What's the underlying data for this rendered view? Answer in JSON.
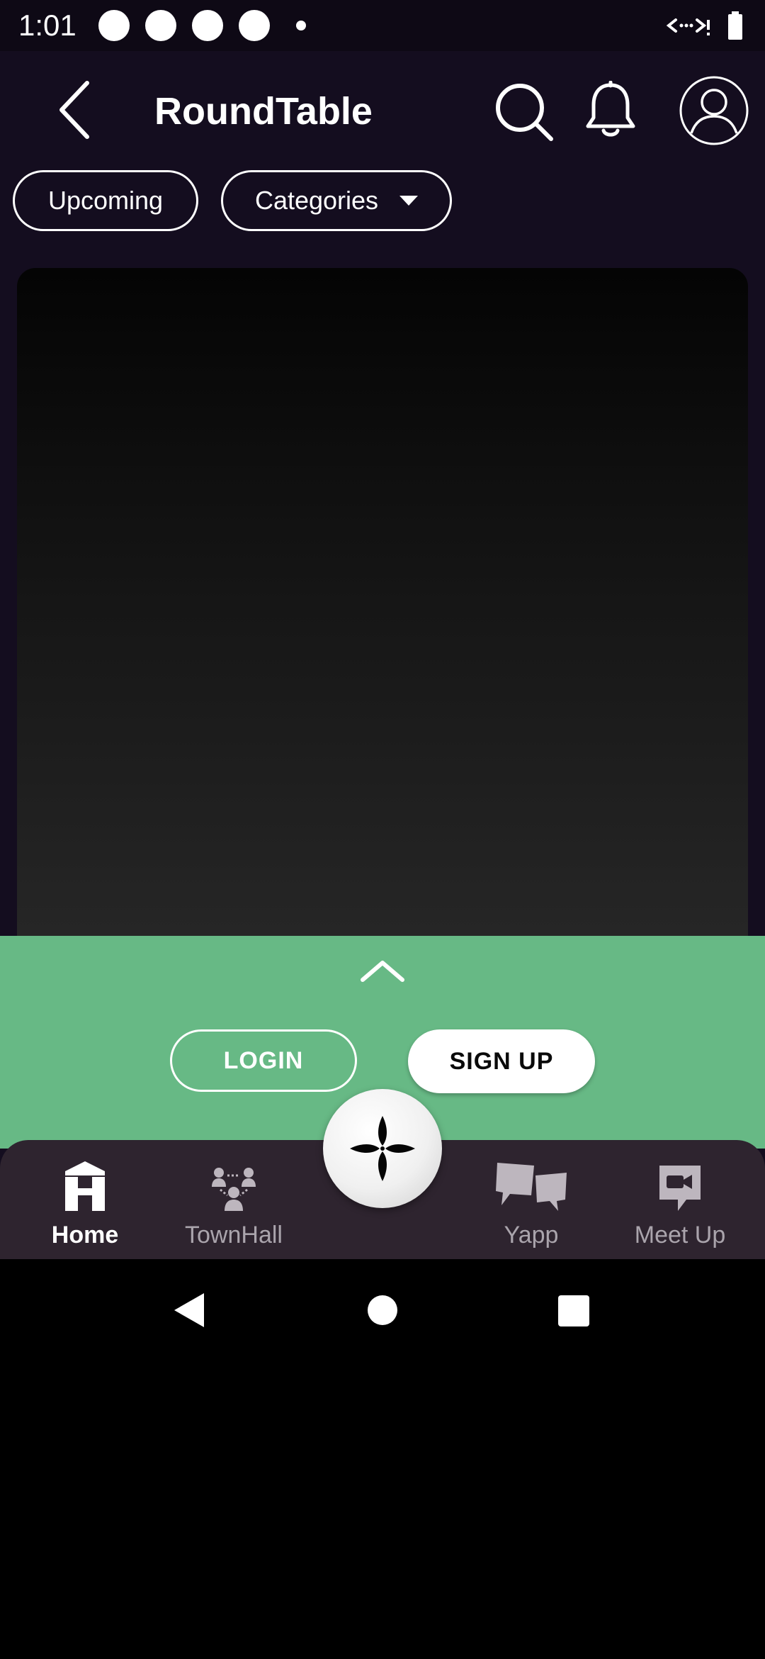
{
  "status_bar": {
    "time": "1:01"
  },
  "header": {
    "title": "RoundTable",
    "icons": [
      "back-arrow-icon",
      "search-icon",
      "bell-icon",
      "profile-icon"
    ]
  },
  "filters": {
    "upcoming_label": "Upcoming",
    "categories_label": "Categories"
  },
  "auth": {
    "login_label": "LOGIN",
    "signup_label": "SIGN UP"
  },
  "bottom_nav": {
    "items": [
      {
        "label": "Home",
        "icon": "home-icon",
        "active": true
      },
      {
        "label": "TownHall",
        "icon": "townhall-icon",
        "active": false
      },
      {
        "label": "Yapp",
        "icon": "yapp-icon",
        "active": false
      },
      {
        "label": "Meet Up",
        "icon": "meetup-icon",
        "active": false
      }
    ],
    "center_icon": "sparkle-icon"
  },
  "colors": {
    "app_background": "#140d1f",
    "auth_panel": "#67b985",
    "bottom_nav": "#2e242f",
    "inactive_label": "#aaa4ac"
  }
}
